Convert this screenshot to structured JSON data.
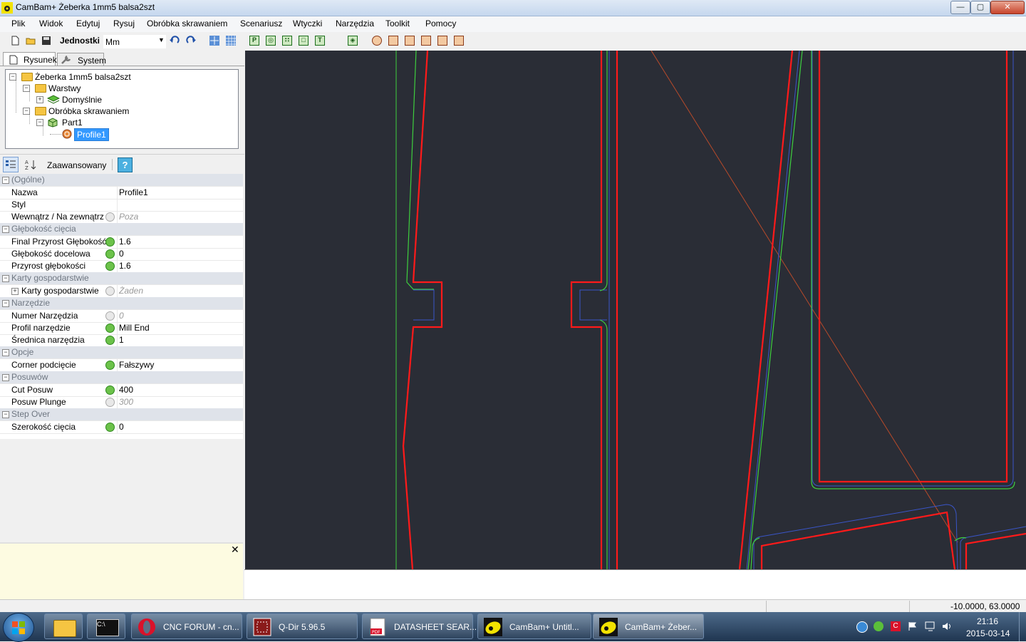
{
  "window": {
    "title": "CamBam+  Żeberka 1mm5 balsa2szt",
    "min": "—",
    "max": "▢",
    "close": "✕"
  },
  "menu": [
    "Plik",
    "Widok",
    "Edytuj",
    "Rysuj",
    "Obróbka skrawaniem",
    "Scenariusz",
    "Wtyczki",
    "Narzędzia",
    "Toolkit",
    "Pomocy"
  ],
  "toolbar": {
    "units_label": "Jednostki",
    "units_value": "Mm"
  },
  "tabs": {
    "drawing": "Rysunek",
    "system": "System"
  },
  "tree": {
    "root": "Żeberka 1mm5 balsa2szt",
    "layers": "Warstwy",
    "default_layer": "Domyślnie",
    "machining": "Obróbka skrawaniem",
    "part": "Part1",
    "profile": "Profile1"
  },
  "props_toolbar": {
    "advanced": "Zaawansowany",
    "help": "?"
  },
  "properties": [
    {
      "type": "cat",
      "label": "(Ogólne)"
    },
    {
      "type": "row",
      "name": "Nazwa",
      "value": "Profile1",
      "icon": "none",
      "ro": false
    },
    {
      "type": "row",
      "name": "Styl",
      "value": "",
      "icon": "none",
      "ro": false
    },
    {
      "type": "row",
      "name": "Wewnątrz / Na zewnątrz",
      "value": "Poza",
      "icon": "gray",
      "ro": true
    },
    {
      "type": "cat",
      "label": "Głębokość cięcia"
    },
    {
      "type": "row",
      "name": "Final Przyrost Głębokość",
      "value": "1.6",
      "icon": "green",
      "ro": false
    },
    {
      "type": "row",
      "name": "Głębokość docelowa",
      "value": "0",
      "icon": "green",
      "ro": false
    },
    {
      "type": "row",
      "name": "Przyrost głębokości",
      "value": "1.6",
      "icon": "green",
      "ro": false
    },
    {
      "type": "cat",
      "label": "Karty gospodarstwie"
    },
    {
      "type": "row",
      "name": "Karty gospodarstwie",
      "value": "Żaden",
      "icon": "gray",
      "ro": true,
      "expander": true
    },
    {
      "type": "cat",
      "label": "Narzędzie"
    },
    {
      "type": "row",
      "name": "Numer Narzędzia",
      "value": "0",
      "icon": "gray",
      "ro": true
    },
    {
      "type": "row",
      "name": "Profil narzędzie",
      "value": "Mill End",
      "icon": "green",
      "ro": false
    },
    {
      "type": "row",
      "name": "Średnica narzędzia",
      "value": "1",
      "icon": "green",
      "ro": false
    },
    {
      "type": "cat",
      "label": "Opcje"
    },
    {
      "type": "row",
      "name": "Corner podcięcie",
      "value": "Fałszywy",
      "icon": "green",
      "ro": false
    },
    {
      "type": "cat",
      "label": "Posuwów"
    },
    {
      "type": "row",
      "name": "Cut Posuw",
      "value": "400",
      "icon": "green",
      "ro": false
    },
    {
      "type": "row",
      "name": "Posuw Plunge",
      "value": "300",
      "icon": "gray",
      "ro": true
    },
    {
      "type": "cat",
      "label": "Step Over"
    },
    {
      "type": "row",
      "name": "Szerokość cięcia",
      "value": "0",
      "icon": "green",
      "ro": false
    }
  ],
  "help_close": "✕",
  "status": {
    "coords": "-10.0000, 63.0000"
  },
  "taskbar": {
    "tasks": [
      "CNC FORUM - cn...",
      "Q-Dir 5.96.5",
      "DATASHEET SEAR...",
      "CamBam+  Untitl...",
      "CamBam+  Żeber..."
    ],
    "time": "21:16",
    "date": "2015-03-14"
  },
  "colors": {
    "canvas_bg": "#2a2d36",
    "toolpath": "#ff1a1a",
    "outline_green": "#3ecf3e",
    "outline_blue": "#3a55c8",
    "guide": "#b84a2a",
    "selection": "#3399ff"
  }
}
